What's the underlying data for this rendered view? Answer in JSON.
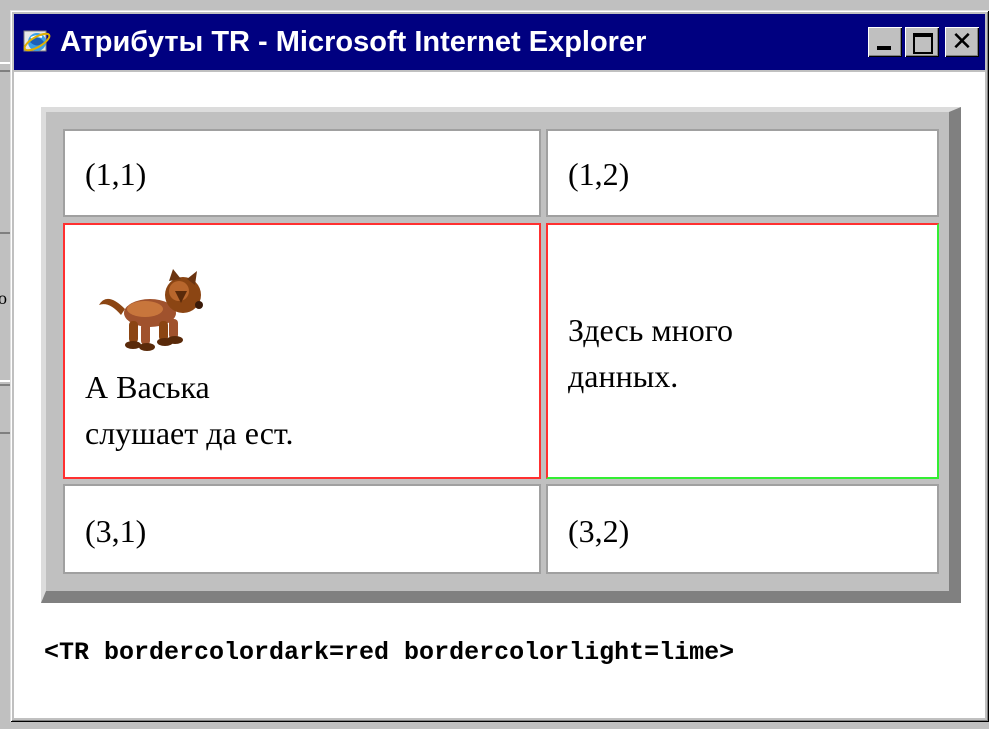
{
  "window": {
    "title": "Атрибуты TR - Microsoft Internet Explorer",
    "controls": {
      "minimize": "minimize",
      "maximize": "maximize",
      "close": "close"
    }
  },
  "background_fragment": {
    "char": "о"
  },
  "table": {
    "rows": [
      {
        "cells": [
          "(1,1)",
          "(1,2)"
        ]
      },
      {
        "cells": [
          "А Васька слушает да ест.",
          "Здесь много данных."
        ],
        "cell1_line1": "А Васька",
        "cell1_line2": "слушает да ест.",
        "cell2_line1": "Здесь много",
        "cell2_line2": "данных."
      },
      {
        "cells": [
          "(3,1)",
          "(3,2)"
        ]
      }
    ],
    "row2_colors": {
      "bordercolordark": "#ff0000",
      "bordercolorlight": "#00ff00"
    }
  },
  "code_caption": "<TR bordercolordark=red bordercolorlight=lime>",
  "icons": {
    "app": "internet-explorer-icon",
    "image": "cat-image"
  }
}
